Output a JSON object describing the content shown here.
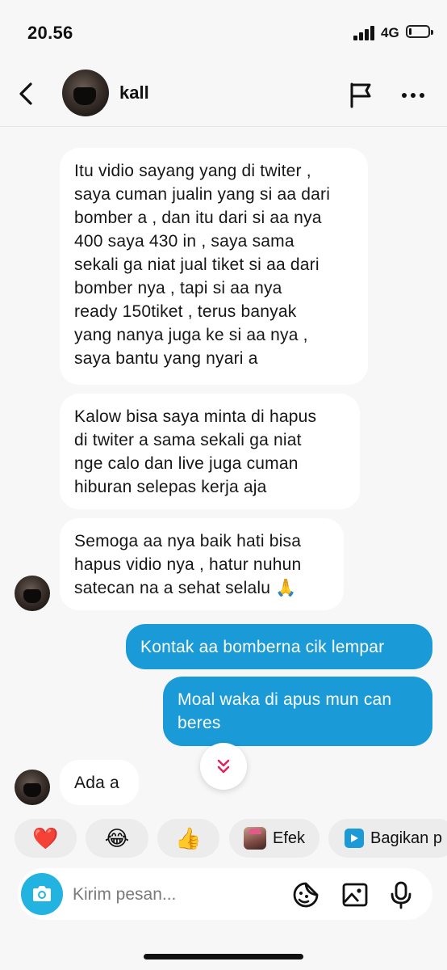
{
  "status_bar": {
    "time": "20.56",
    "network": "4G",
    "battery_level": 0.15
  },
  "header": {
    "username": "kall",
    "icons": [
      "back-icon",
      "flag-icon",
      "more-icon"
    ]
  },
  "messages": [
    {
      "side": "received",
      "text": "Itu vidio sayang yang di twiter ,\nsaya cuman jualin yang si aa dari\nbomber a , dan itu dari si aa nya\n400 saya 430 in , saya sama\nsekali ga niat jual tiket si aa dari\nbomber nya , tapi si aa nya\nready 150tiket , terus banyak\nyang nanya juga ke si aa nya ,\nsaya bantu yang nyari a"
    },
    {
      "side": "received",
      "text": "Kalow bisa saya minta di hapus\ndi twiter a sama sekali ga niat\nnge calo dan live juga cuman\nhiburan selepas kerja aja"
    },
    {
      "side": "received",
      "text": "Semoga aa nya baik hati bisa\nhapus vidio nya , hatur nuhun\nsatecan na a sehat selalu 🙏"
    },
    {
      "side": "sent",
      "text": "Kontak aa bomberna cik lempar"
    },
    {
      "side": "sent",
      "text": "Moal waka di apus mun can\nberes"
    },
    {
      "side": "received",
      "text": "Ada a"
    }
  ],
  "quick_replies": [
    {
      "emoji": "❤️",
      "icon": "heart-icon"
    },
    {
      "emoji": "😂",
      "icon": "laughing-face-icon"
    },
    {
      "emoji": "👍",
      "icon": "thumbs-up-icon"
    },
    {
      "label": "Efek",
      "icon": "effect-thumbnail-icon"
    },
    {
      "label": "Bagikan p",
      "icon": "share-play-icon"
    }
  ],
  "composer": {
    "placeholder": "Kirim pesan...",
    "icons": [
      "camera-icon",
      "sticker-icon",
      "image-icon",
      "microphone-icon"
    ]
  },
  "colors": {
    "sent_bubble": "#1a9bd7",
    "received_bubble": "#ffffff",
    "background": "#f7f7f7",
    "camera_button": "#22b3e0",
    "scroll_chevron": "#e0245e"
  }
}
